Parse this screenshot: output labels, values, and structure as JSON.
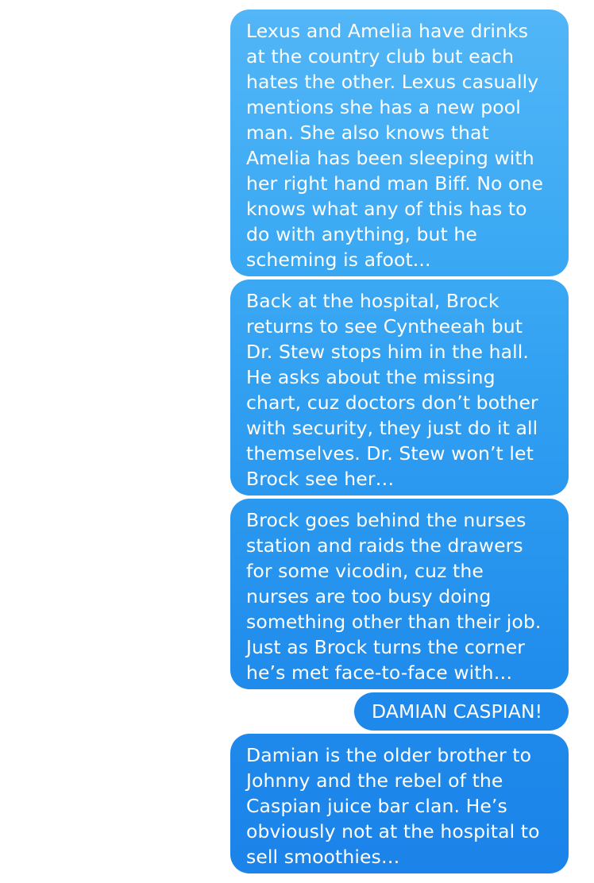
{
  "conversation": {
    "messages": [
      {
        "direction": "outgoing",
        "text": "Lexus and Amelia have drinks\nat the country club but each\nhates the other. Lexus casually\nmentions she has a new pool\nman. She also knows that\nAmelia has been sleeping with\nher right hand man Biff. No one\nknows what any of this has to\ndo with anything, but he\nscheming is afoot..."
      },
      {
        "direction": "outgoing",
        "text": "Back at the hospital, Brock\nreturns to see Cyntheeah but\nDr. Stew stops him in the hall.\nHe asks about the missing\nchart, cuz doctors don’t bother\nwith security, they just do it all\nthemselves. Dr. Stew won’t let\nBrock see her…"
      },
      {
        "direction": "outgoing",
        "text": "Brock goes behind the nurses\nstation and raids the drawers\nfor some vicodin, cuz the\nnurses are too busy doing\nsomething other than their job.\nJust as Brock turns the corner\nhe’s met face-to-face with…"
      },
      {
        "direction": "outgoing",
        "text": "DAMIAN CASPIAN!"
      },
      {
        "direction": "outgoing",
        "text": "Damian is the older brother to\nJohnny and the rebel of the\nCaspian juice bar clan. He’s\nobviously not at the hospital to\nsell smoothies…"
      }
    ]
  },
  "colors": {
    "bubble_top": "#52b6f7",
    "bubble_bottom": "#1b83e9",
    "text": "#ffffff",
    "background": "#ffffff"
  }
}
